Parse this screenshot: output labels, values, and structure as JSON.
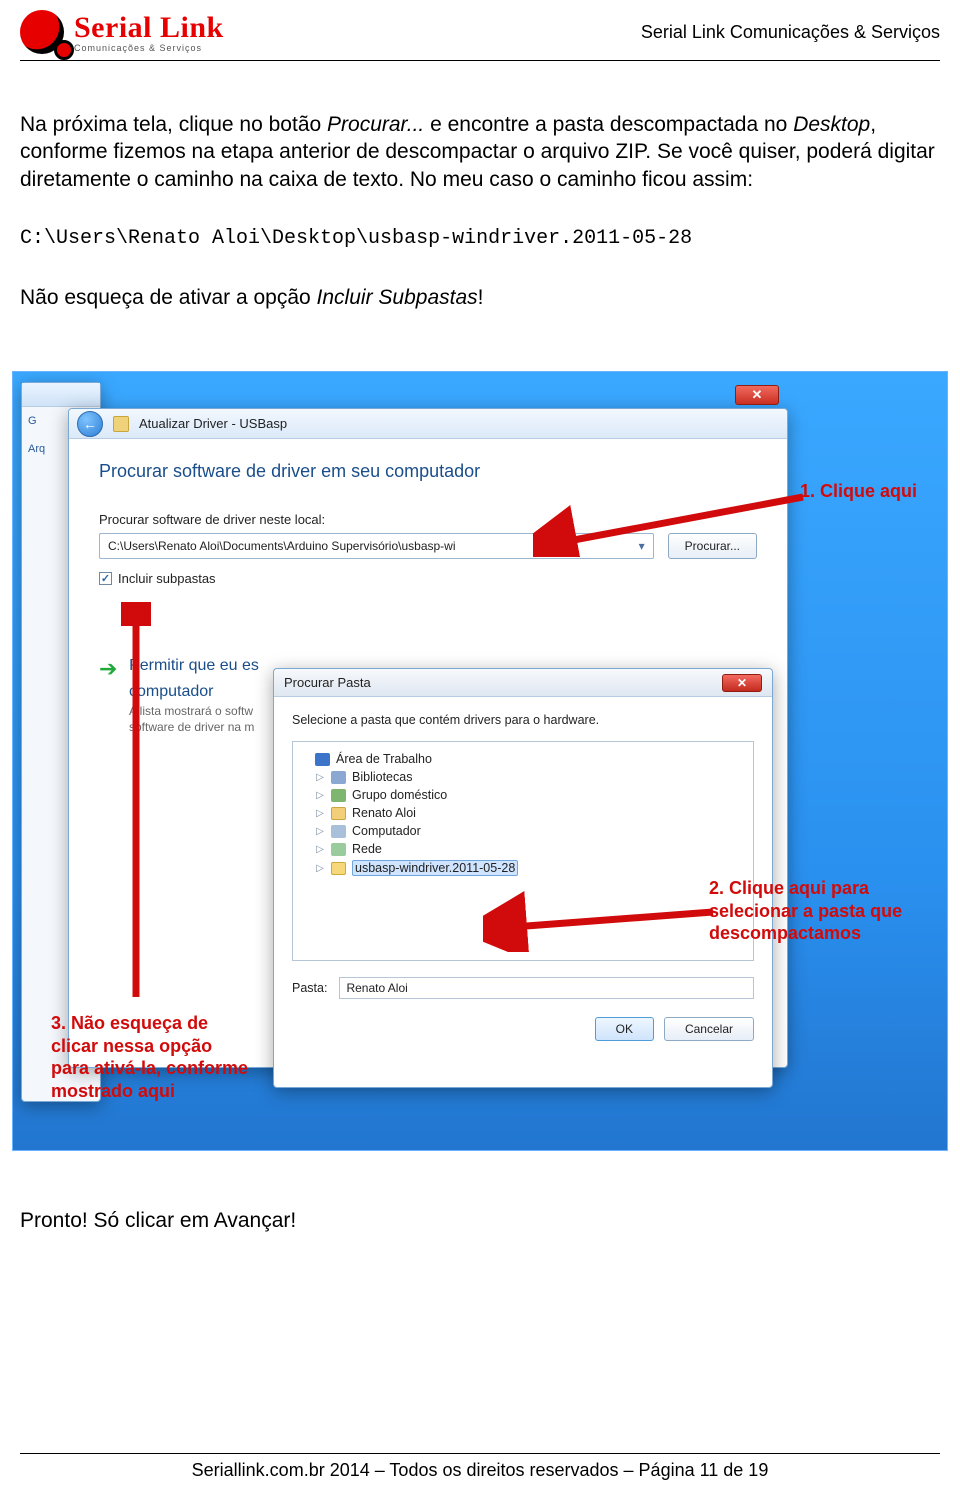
{
  "header": {
    "brand_main": "Serial Link",
    "brand_sub": "Comunicações & Serviços",
    "brand_right": "Serial Link Comunicações & Serviços"
  },
  "doc": {
    "para1_a": "Na próxima tela, clique no botão ",
    "para1_i": "Procurar...",
    "para1_b": " e encontre a pasta descompactada no ",
    "para1_i2": "Desktop",
    "para1_c": ", conforme fizemos na etapa anterior de descompactar o arquivo ZIP. Se você quiser, poderá digitar diretamente o caminho na caixa de texto. No meu caso o caminho ficou assim:",
    "mono_path": "C:\\Users\\Renato Aloi\\Desktop\\usbasp-windriver.2011-05-28",
    "para2_a": "Não esqueça de ativar a opção ",
    "para2_i": "Incluir Subpastas",
    "para2_b": "!",
    "after_a": "Pronto! Só clicar em ",
    "after_i": "Avançar",
    "after_b": "!"
  },
  "bgwin": {
    "line1": "G",
    "line2": "Arq"
  },
  "mainwin": {
    "title": "Atualizar Driver - USBasp",
    "heading": "Procurar software de driver em seu computador",
    "pathLabel": "Procurar software de driver neste local:",
    "pathValue": "C:\\Users\\Renato Aloi\\Documents\\Arduino Supervisório\\usbasp-wi",
    "browseBtn": "Procurar...",
    "includeSub": "Incluir subpastas",
    "permit1": "Permitir que eu es",
    "permit2": "computador",
    "permitSub1": "A lista mostrará o softw",
    "permitSub2": "software de driver na m"
  },
  "browse": {
    "title": "Procurar Pasta",
    "subtitle": "Selecione a pasta que contém drivers para o hardware.",
    "items": [
      {
        "name": "Área de Trabalho",
        "icon": "ic-desktop",
        "indent": "indent1",
        "tri": ""
      },
      {
        "name": "Bibliotecas",
        "icon": "ic-lib",
        "indent": "indent2",
        "tri": "▷"
      },
      {
        "name": "Grupo doméstico",
        "icon": "ic-group",
        "indent": "indent2",
        "tri": "▷"
      },
      {
        "name": "Renato Aloi",
        "icon": "ic-user",
        "indent": "indent2",
        "tri": "▷"
      },
      {
        "name": "Computador",
        "icon": "ic-pc",
        "indent": "indent2",
        "tri": "▷"
      },
      {
        "name": "Rede",
        "icon": "ic-net",
        "indent": "indent2",
        "tri": "▷"
      },
      {
        "name": "usbasp-windriver.2011-05-28",
        "icon": "ic-folder",
        "indent": "indent2",
        "tri": "▷",
        "sel": true
      }
    ],
    "pastaLabel": "Pasta:",
    "pastaValue": "Renato Aloi",
    "ok": "OK",
    "cancel": "Cancelar"
  },
  "annotations": {
    "a1": "1. Clique aqui",
    "a2": "2. Clique aqui para selecionar a pasta que descompactamos",
    "a3": "3. Não esqueça de clicar nessa opção para ativá-la, conforme mostrado aqui"
  },
  "footer": {
    "text": "Seriallink.com.br 2014 – Todos os direitos reservados – Página 11 de 19"
  }
}
